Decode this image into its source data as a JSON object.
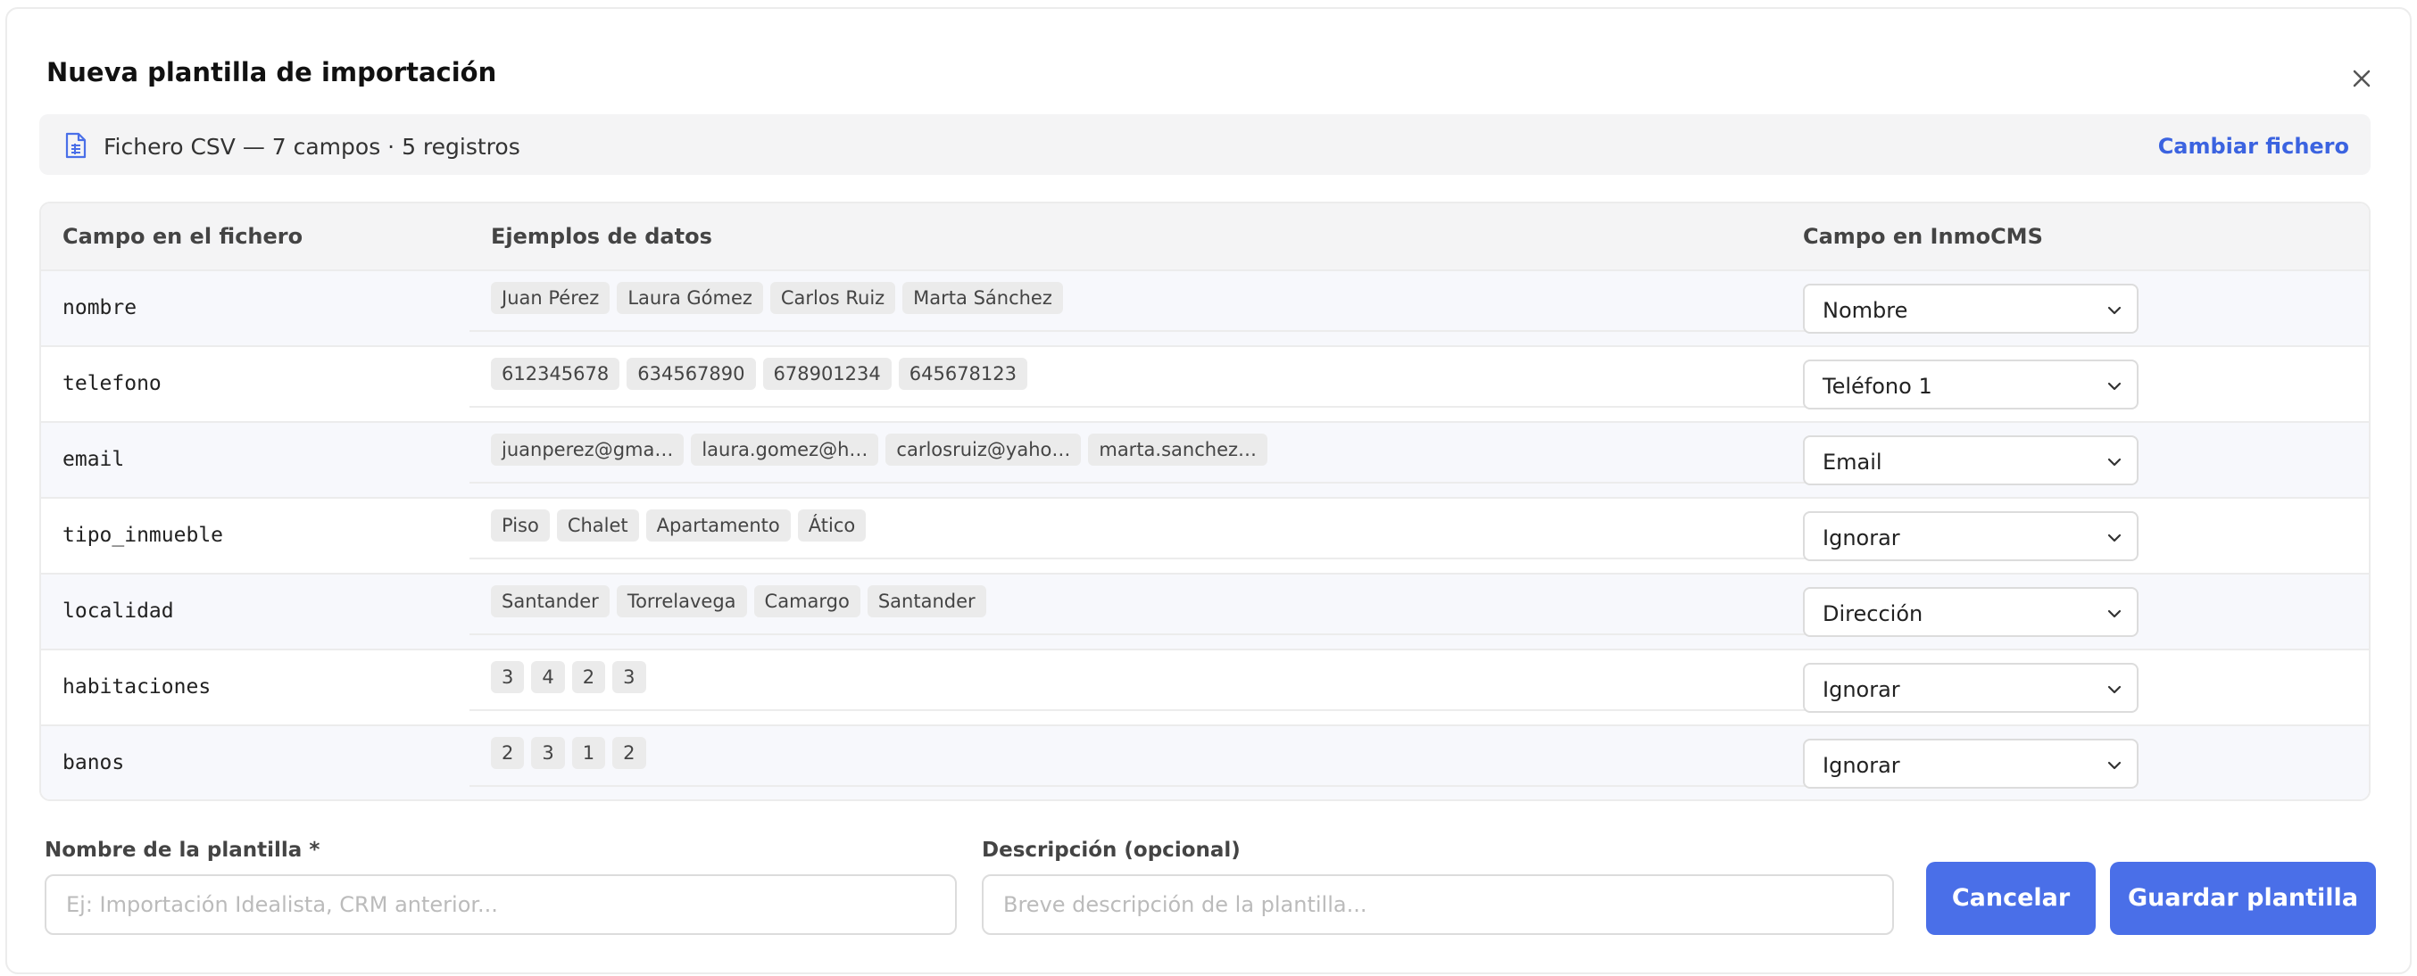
{
  "dialog": {
    "title": "Nueva plantilla de importación"
  },
  "file_bar": {
    "icon": "file-spreadsheet-icon",
    "text": "Fichero CSV — 7 campos · 5 registros",
    "change_link": "Cambiar fichero"
  },
  "table": {
    "headers": {
      "file_field": "Campo en el fichero",
      "examples": "Ejemplos de datos",
      "cms_field": "Campo en InmoCMS"
    },
    "rows": [
      {
        "field": "nombre",
        "examples": [
          "Juan Pérez",
          "Laura Gómez",
          "Carlos Ruiz",
          "Marta Sánchez"
        ],
        "mapping": "Nombre"
      },
      {
        "field": "telefono",
        "examples": [
          "612345678",
          "634567890",
          "678901234",
          "645678123"
        ],
        "mapping": "Teléfono 1"
      },
      {
        "field": "email",
        "examples": [
          "juanperez@gma…",
          "laura.gomez@h…",
          "carlosruiz@yaho…",
          "marta.sanchez…"
        ],
        "mapping": "Email"
      },
      {
        "field": "tipo_inmueble",
        "examples": [
          "Piso",
          "Chalet",
          "Apartamento",
          "Ático"
        ],
        "mapping": "Ignorar"
      },
      {
        "field": "localidad",
        "examples": [
          "Santander",
          "Torrelavega",
          "Camargo",
          "Santander"
        ],
        "mapping": "Dirección"
      },
      {
        "field": "habitaciones",
        "examples": [
          "3",
          "4",
          "2",
          "3"
        ],
        "mapping": "Ignorar"
      },
      {
        "field": "banos",
        "examples": [
          "2",
          "3",
          "1",
          "2"
        ],
        "mapping": "Ignorar"
      }
    ]
  },
  "form": {
    "name_label": "Nombre de la plantilla *",
    "name_placeholder": "Ej: Importación Idealista, CRM anterior...",
    "name_value": "",
    "description_label": "Descripción (opcional)",
    "description_placeholder": "Breve descripción de la plantilla...",
    "description_value": ""
  },
  "actions": {
    "cancel": "Cancelar",
    "save": "Guardar plantilla"
  },
  "colors": {
    "accent": "#4a6fe8",
    "link": "#3b63e0"
  }
}
